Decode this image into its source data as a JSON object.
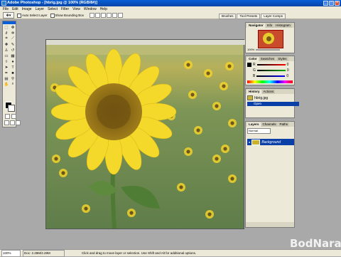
{
  "window": {
    "title": "Adobe Photoshop - [hbrig.jpg @ 100% (RGB/8#)]",
    "min": "_",
    "max": "□",
    "close": "×"
  },
  "menu": [
    "File",
    "Edit",
    "Image",
    "Layer",
    "Select",
    "Filter",
    "View",
    "Window",
    "Help"
  ],
  "options": {
    "auto_select_layer": "Auto Select Layer",
    "show_bounding_box": "Show Bounding Box"
  },
  "palette_well": [
    "Brushes",
    "Tool Presets",
    "Layer Comps"
  ],
  "navigator": {
    "tabs": [
      "Navigator",
      "Info",
      "Histogram"
    ],
    "zoom": "100%"
  },
  "color_panel": {
    "tabs": [
      "Color",
      "Swatches",
      "Styles"
    ],
    "sliders": [
      {
        "label": "R",
        "value": "0",
        "color": "#ff0000"
      },
      {
        "label": "G",
        "value": "0",
        "color": "#00aa00"
      },
      {
        "label": "B",
        "value": "0",
        "color": "#0000ff"
      }
    ]
  },
  "history": {
    "tabs": [
      "History",
      "Actions"
    ],
    "snapshot": "hbrig.jpg",
    "items": [
      "Open"
    ]
  },
  "layers": {
    "tabs": [
      "Layers",
      "Channels",
      "Paths"
    ],
    "mode": "Normal",
    "layer": "Background"
  },
  "status": {
    "zoom": "100%",
    "doc": "Doc: 2.28M/2.28M",
    "hint": "Click and drag to move layer or selection. Use Shift and Alt for additional options."
  },
  "watermark": "BodNara"
}
